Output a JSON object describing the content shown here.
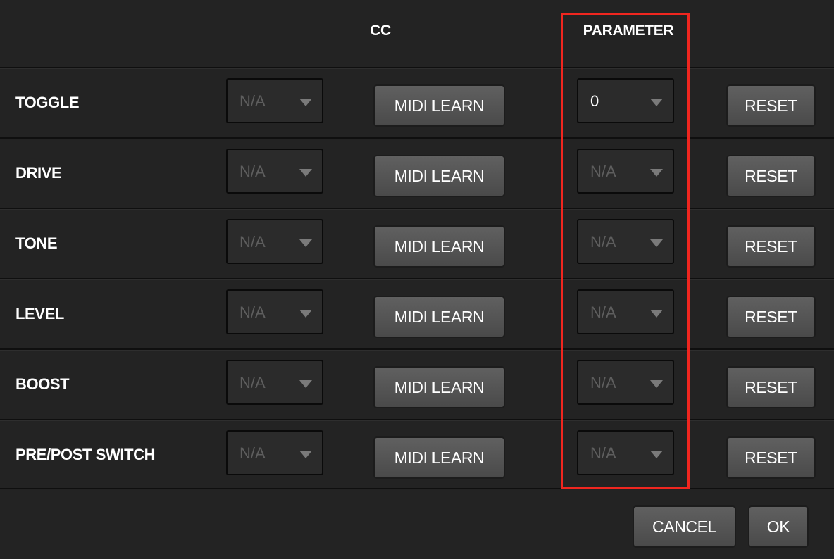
{
  "header": {
    "cc": "CC",
    "parameter": "PARAMETER"
  },
  "rows": [
    {
      "label": "TOGGLE",
      "cc": "N/A",
      "parameter": "0",
      "midi_learn": "MIDI LEARN",
      "reset": "RESET"
    },
    {
      "label": "DRIVE",
      "cc": "N/A",
      "parameter": "N/A",
      "midi_learn": "MIDI LEARN",
      "reset": "RESET"
    },
    {
      "label": "TONE",
      "cc": "N/A",
      "parameter": "N/A",
      "midi_learn": "MIDI LEARN",
      "reset": "RESET"
    },
    {
      "label": "LEVEL",
      "cc": "N/A",
      "parameter": "N/A",
      "midi_learn": "MIDI LEARN",
      "reset": "RESET"
    },
    {
      "label": "BOOST",
      "cc": "N/A",
      "parameter": "N/A",
      "midi_learn": "MIDI LEARN",
      "reset": "RESET"
    },
    {
      "label": "PRE/POST SWITCH",
      "cc": "N/A",
      "parameter": "N/A",
      "midi_learn": "MIDI LEARN",
      "reset": "RESET"
    }
  ],
  "footer": {
    "cancel": "CANCEL",
    "ok": "OK"
  },
  "colors": {
    "background": "#232323",
    "highlight": "#f0261f",
    "button": "#555555"
  }
}
